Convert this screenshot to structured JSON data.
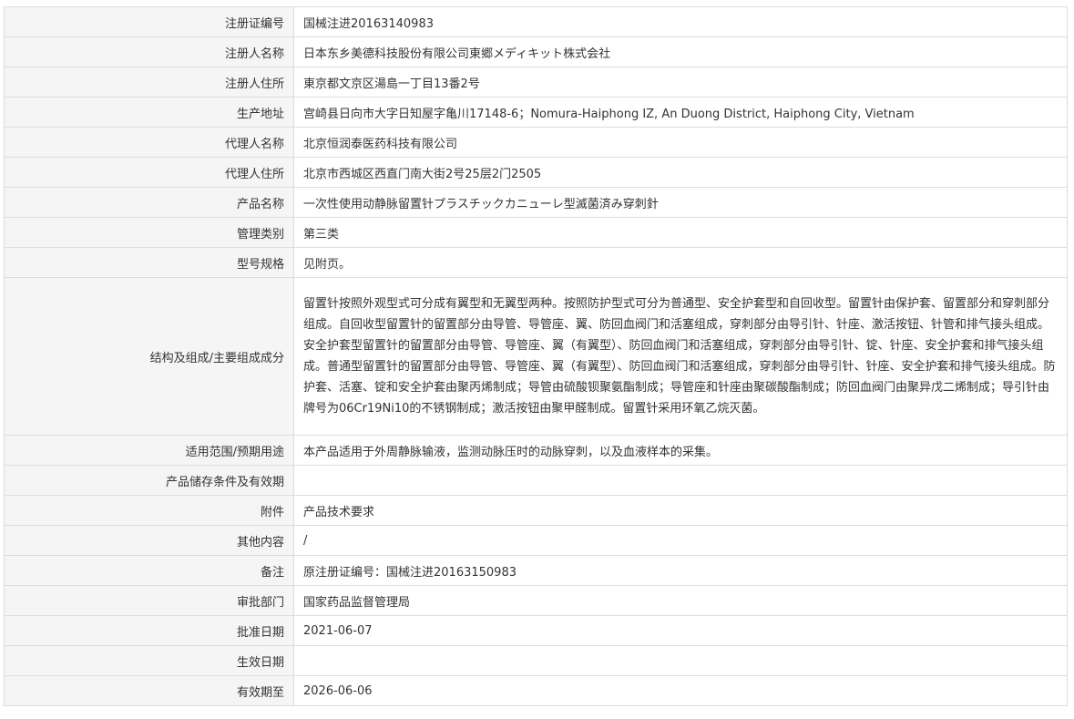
{
  "rows": [
    {
      "label": "注册证编号",
      "value": "国械注进20163140983"
    },
    {
      "label": "注册人名称",
      "value": "日本东乡美德科技股份有限公司東郷メディキット株式会社"
    },
    {
      "label": "注册人住所",
      "value": "東京都文京区湯島一丁目13番2号"
    },
    {
      "label": "生产地址",
      "value": "宫崎县日向市大字日知屋字亀川17148-6；Nomura-Haiphong IZ, An Duong District, Haiphong City, Vietnam"
    },
    {
      "label": "代理人名称",
      "value": "北京恒润泰医药科技有限公司"
    },
    {
      "label": "代理人住所",
      "value": "北京市西城区西直门南大街2号25层2门2505"
    },
    {
      "label": "产品名称",
      "value": "一次性使用动静脉留置针プラスチックカニューレ型滅菌済み穿刺針"
    },
    {
      "label": "管理类别",
      "value": "第三类"
    },
    {
      "label": "型号规格",
      "value": "见附页。"
    },
    {
      "label": "结构及组成/主要组成成分",
      "value": "留置针按照外观型式可分成有翼型和无翼型两种。按照防护型式可分为普通型、安全护套型和自回收型。留置针由保护套、留置部分和穿刺部分组成。自回收型留置针的留置部分由导管、导管座、翼、防回血阀门和活塞组成，穿刺部分由导引针、针座、激活按钮、针管和排气接头组成。安全护套型留置针的留置部分由导管、导管座、翼（有翼型）、防回血阀门和活塞组成，穿刺部分由导引针、锭、针座、安全护套和排气接头组成。普通型留置针的留置部分由导管、导管座、翼（有翼型）、防回血阀门和活塞组成，穿刺部分由导引针、针座、安全护套和排气接头组成。防护套、活塞、锭和安全护套由聚丙烯制成；导管由硫酸钡聚氨酯制成；导管座和针座由聚碳酸酯制成；防回血阀门由聚异戊二烯制成；导引针由牌号为06Cr19Ni10的不锈钢制成；激活按钮由聚甲醛制成。留置针采用环氧乙烷灭菌。"
    },
    {
      "label": "适用范围/预期用途",
      "value": "本产品适用于外周静脉输液，监测动脉压时的动脉穿刺，以及血液样本的采集。"
    },
    {
      "label": "产品储存条件及有效期",
      "value": ""
    },
    {
      "label": "附件",
      "value": "产品技术要求"
    },
    {
      "label": "其他内容",
      "value": "/"
    },
    {
      "label": "备注",
      "value": "原注册证编号：国械注进20163150983"
    },
    {
      "label": "审批部门",
      "value": "国家药品监督管理局"
    },
    {
      "label": "批准日期",
      "value": "2021-06-07"
    },
    {
      "label": "生效日期",
      "value": ""
    },
    {
      "label": "有效期至",
      "value": "2026-06-06"
    }
  ]
}
